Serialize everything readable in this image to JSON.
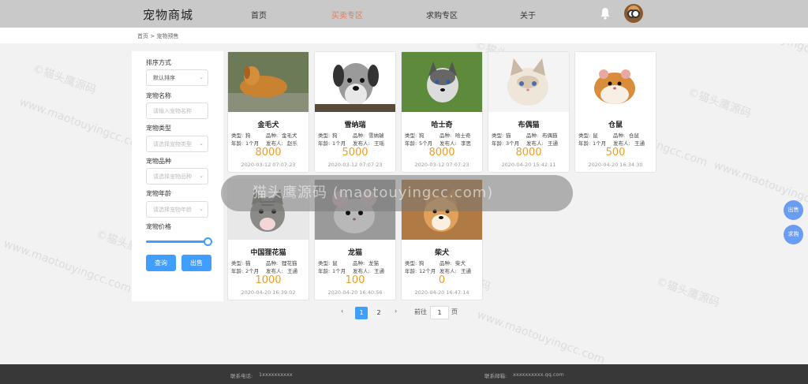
{
  "header": {
    "brand": "宠物商城",
    "nav": [
      {
        "label": "首页",
        "active": false
      },
      {
        "label": "买卖专区",
        "active": true
      },
      {
        "label": "求购专区",
        "active": false
      },
      {
        "label": "关于",
        "active": false
      }
    ]
  },
  "breadcrumb": "首页 > 宠物预售",
  "filters": {
    "sort_label": "排序方式",
    "sort_value": "默认排序",
    "name_label": "宠物名称",
    "name_placeholder": "请输入宠物名称",
    "type_label": "宠物类型",
    "type_placeholder": "请选择宠物类型",
    "breed_label": "宠物品种",
    "breed_placeholder": "请选择宠物品种",
    "age_label": "宠物年龄",
    "age_placeholder": "请选择宠物年龄",
    "price_label": "宠物价格",
    "price_slider_value": 1.0,
    "search_button": "查询",
    "sell_button": "出售"
  },
  "cards": [
    {
      "name": "金毛犬",
      "type_label": "类型:",
      "type": "狗",
      "breed_label": "品种:",
      "breed": "金毛犬",
      "age_label": "年龄:",
      "age": "1个月",
      "publisher_label": "发布人:",
      "publisher": "赵乐",
      "price": "8000",
      "time": "2020-03-12 07:07:23",
      "photo": "golden"
    },
    {
      "name": "雪纳瑞",
      "type_label": "类型:",
      "type": "狗",
      "breed_label": "品种:",
      "breed": "雪纳瑞",
      "age_label": "年龄:",
      "age": "1个月",
      "publisher_label": "发布人:",
      "publisher": "王瑶",
      "price": "5000",
      "time": "2020-03-12 07:07:23",
      "photo": "schnauzer"
    },
    {
      "name": "哈士奇",
      "type_label": "类型:",
      "type": "狗",
      "breed_label": "品种:",
      "breed": "哈士奇",
      "age_label": "年龄:",
      "age": "5个月",
      "publisher_label": "发布人:",
      "publisher": "李思",
      "price": "8000",
      "time": "2020-03-12 07:07:23",
      "photo": "husky"
    },
    {
      "name": "布偶猫",
      "type_label": "类型:",
      "type": "猫",
      "breed_label": "品种:",
      "breed": "布偶猫",
      "age_label": "年龄:",
      "age": "3个月",
      "publisher_label": "发布人:",
      "publisher": "王通",
      "price": "8000",
      "time": "2020-04-20 15:42:11",
      "photo": "ragdoll"
    },
    {
      "name": "仓鼠",
      "type_label": "类型:",
      "type": "鼠",
      "breed_label": "品种:",
      "breed": "仓鼠",
      "age_label": "年龄:",
      "age": "1个月",
      "publisher_label": "发布人:",
      "publisher": "王通",
      "price": "500",
      "time": "2020-04-20 16:34:30",
      "photo": "hamster"
    },
    {
      "name": "中国狸花猫",
      "type_label": "类型:",
      "type": "猫",
      "breed_label": "品种:",
      "breed": "狸花猫",
      "age_label": "年龄:",
      "age": "2个月",
      "publisher_label": "发布人:",
      "publisher": "王通",
      "price": "1000",
      "time": "2020-04-20 16:39:02",
      "photo": "tabby"
    },
    {
      "name": "龙猫",
      "type_label": "类型:",
      "type": "鼠",
      "breed_label": "品种:",
      "breed": "龙猫",
      "age_label": "年龄:",
      "age": "1个月",
      "publisher_label": "发布人:",
      "publisher": "王通",
      "price": "100",
      "time": "2020-04-20 16:40:56",
      "photo": "chinchilla"
    },
    {
      "name": "柴犬",
      "type_label": "类型:",
      "type": "狗",
      "breed_label": "品种:",
      "breed": "柴犬",
      "age_label": "年龄:",
      "age": "12个月",
      "publisher_label": "发布人:",
      "publisher": "王通",
      "price": "0",
      "time": "2020-04-20 16:47:14",
      "photo": "shiba"
    }
  ],
  "pagination": {
    "prev": "‹",
    "pages": [
      "1",
      "2"
    ],
    "current": "1",
    "next": "›",
    "goto_label": "前往",
    "goto_value": "1",
    "page_suffix": "页"
  },
  "float_buttons": {
    "sell": "出售",
    "buy": "求购"
  },
  "footer": {
    "phone_label": "联系电话:",
    "phone": "1xxxxxxxxxx",
    "email_label": "联系邮箱:",
    "email": "xxxxxxxxxx.qq.com"
  },
  "overlay_text": "猫头鹰源码 (maotouyingcc.com)",
  "watermark": {
    "cn": "©猫头鹰源码",
    "en": "www.maotouyingcc.com"
  },
  "colors": {
    "accent": "#409eff",
    "nav_active": "#f07850",
    "price": "#f29c1f",
    "header_bg": "#c9c9c9",
    "footer_bg": "#383838"
  }
}
